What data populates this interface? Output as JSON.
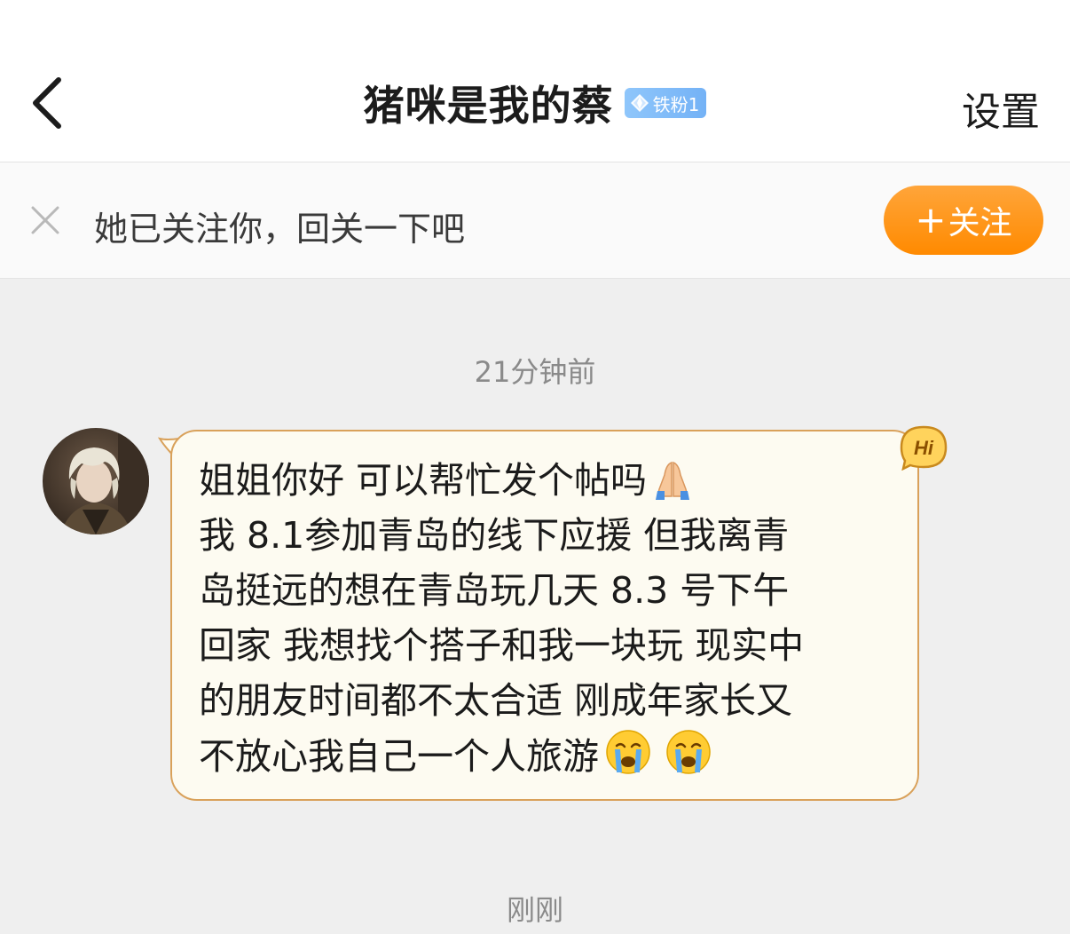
{
  "header": {
    "back_icon": "chevron-left-icon",
    "title": "猪咪是我的蔡",
    "badge": {
      "icon": "diamond-icon",
      "label": "铁粉1",
      "color": "#7bb8f7"
    },
    "settings_label": "设置"
  },
  "follow_banner": {
    "close_icon": "close-icon",
    "text": "她已关注你，回关一下吧",
    "button_plus": "+",
    "button_label": "关注",
    "button_color": "#ff9a1f"
  },
  "chat": {
    "timestamp_top": "21分钟前",
    "message": {
      "sender_avatar": "avatar",
      "lines": [
        "姐姐你好 可以帮忙发个帖吗",
        "我 8.1参加青岛的线下应援 但我离青",
        "岛挺远的想在青岛玩几天 8.3 号下午",
        "回家 我想找个搭子和我一块玩 现实中",
        "的朋友时间都不太合适 刚成年家长又",
        "不放心我自己一个人旅游"
      ],
      "emojis": {
        "line1_end": "praying-hands-emoji",
        "line6_end": [
          "crying-face-emoji",
          "crying-face-emoji"
        ]
      },
      "bubble_badge": "Hi",
      "bubble_border_color": "#d9a15a"
    },
    "timestamp_bottom": "刚刚"
  }
}
